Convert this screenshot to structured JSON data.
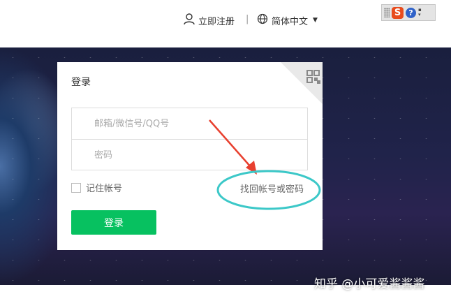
{
  "header": {
    "register_label": "立即注册",
    "separator": "|",
    "language_label": "简体中文"
  },
  "ime_toolbar": {
    "logo_letter": "S",
    "help_symbol": "?"
  },
  "login_card": {
    "title": "登录",
    "account_placeholder": "邮箱/微信号/QQ号",
    "password_placeholder": "密码",
    "remember_label": "记住帐号",
    "forgot_label": "找回帐号或密码",
    "submit_label": "登录"
  },
  "annotation": {
    "arrow_color": "#e8402f",
    "circle_color": "#3cc8c8"
  },
  "watermark": "知乎 @小可爱酱酱酱",
  "colors": {
    "primary_button": "#07c160",
    "background_space": "#1f2245"
  }
}
